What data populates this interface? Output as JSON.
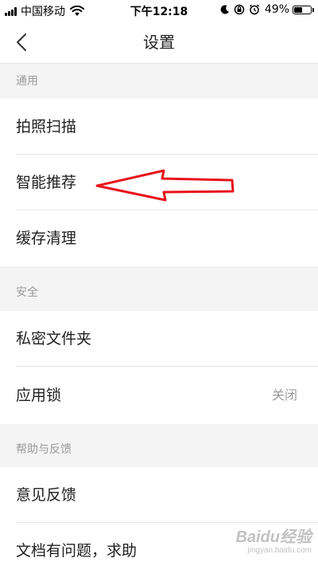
{
  "status_bar": {
    "carrier": "中国移动",
    "time": "下午12:18",
    "battery": "49%"
  },
  "nav": {
    "title": "设置"
  },
  "sections": [
    {
      "header": "通用",
      "items": [
        {
          "label": "拍照扫描"
        },
        {
          "label": "智能推荐"
        },
        {
          "label": "缓存清理"
        }
      ]
    },
    {
      "header": "安全",
      "items": [
        {
          "label": "私密文件夹"
        },
        {
          "label": "应用锁",
          "value": "关闭"
        }
      ]
    },
    {
      "header": "帮助与反馈",
      "items": [
        {
          "label": "意见反馈"
        },
        {
          "label": "文档有问题，求助"
        }
      ]
    }
  ],
  "annotation": {
    "color": "#e8141b"
  },
  "watermark": {
    "text": "Baidu经验",
    "url": "jingyan.baidu.com"
  }
}
